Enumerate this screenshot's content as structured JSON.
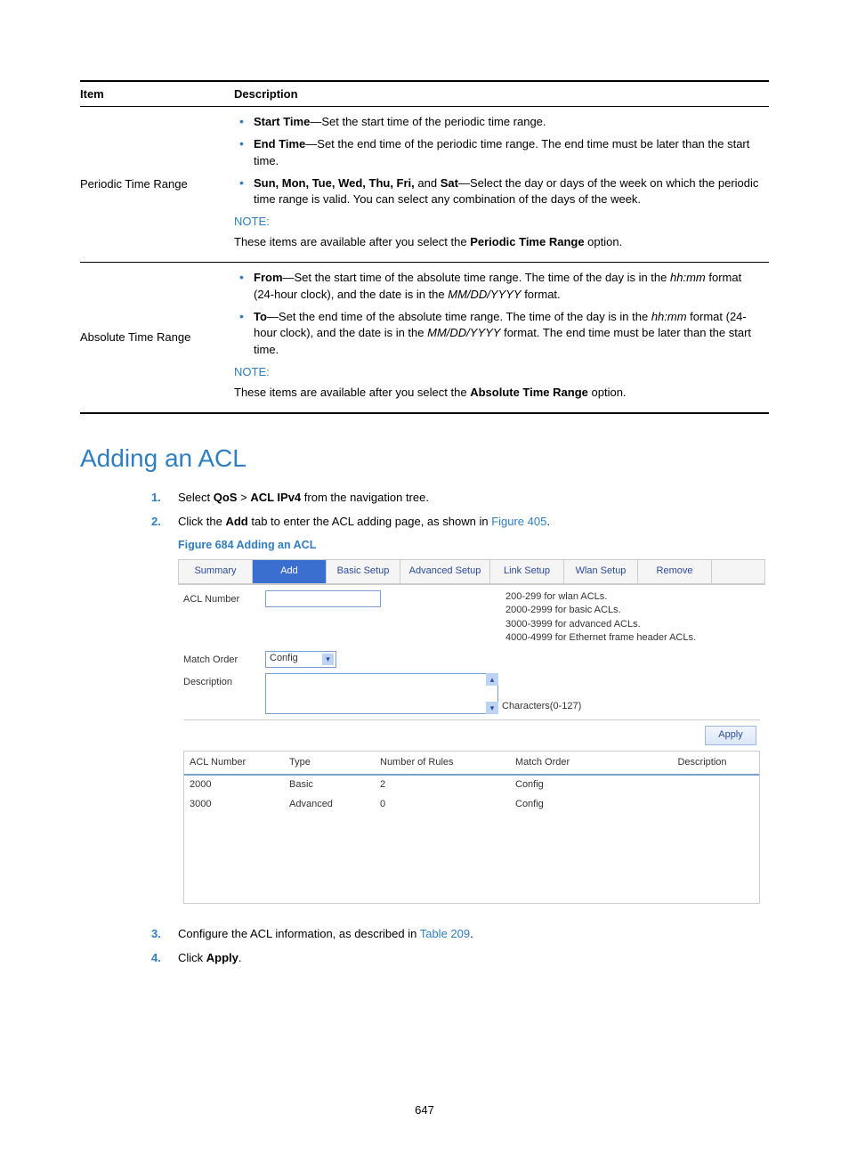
{
  "table": {
    "headers": {
      "item": "Item",
      "description": "Description"
    },
    "rows": [
      {
        "item": "Periodic Time Range",
        "bullets": [
          {
            "label": "Start Time",
            "text": "—Set the start time of the periodic time range."
          },
          {
            "label": "End Time",
            "text": "—Set the end time of the periodic time range. The end time must be later than the start time."
          },
          {
            "label": "",
            "text_prefix": "",
            "days": "Sun, Mon, Tue, Wed, Thu, Fri,",
            "and": " and ",
            "sat": "Sat",
            "text": "—Select the day or days of the week on which the periodic time range is valid. You can select any combination of the days of the week."
          }
        ],
        "note_label": "NOTE:",
        "note_text_pre": "These items are available after you select the ",
        "note_text_bold": "Periodic Time Range",
        "note_text_post": " option."
      },
      {
        "item": "Absolute Time Range",
        "bullets": [
          {
            "label": "From",
            "text": "—Set the start time of the absolute time range. The time of the day is in the ",
            "i1": "hh:mm",
            "mid": " format (24-hour clock), and the date is in the ",
            "i2": "MM/DD/YYYY",
            "tail": " format."
          },
          {
            "label": "To",
            "text": "—Set the end time of the absolute time range. The time of the day is in the ",
            "i1": "hh:mm",
            "mid": " format (24-hour clock), and the date is in the ",
            "i2": "MM/DD/YYYY",
            "tail": " format. The end time must be later than the start time."
          }
        ],
        "note_label": "NOTE:",
        "note_text_pre": "These items are available after you select the ",
        "note_text_bold": "Absolute Time Range",
        "note_text_post": " option."
      }
    ]
  },
  "section_title": "Adding an ACL",
  "steps": {
    "s1_pre": "Select ",
    "s1_b1": "QoS",
    "s1_mid": " > ",
    "s1_b2": "ACL IPv4",
    "s1_post": " from the navigation tree.",
    "s2_pre": "Click the ",
    "s2_b": "Add",
    "s2_mid": " tab to enter the ACL adding page, as shown in ",
    "s2_link": "Figure 405",
    "s2_post": ".",
    "s3_pre": "Configure the ACL information, as described in ",
    "s3_link": "Table 209",
    "s3_post": ".",
    "s4_pre": "Click ",
    "s4_b": "Apply",
    "s4_post": "."
  },
  "figure_caption": "Figure 684 Adding an ACL",
  "ui": {
    "tabs": [
      "Summary",
      "Add",
      "Basic Setup",
      "Advanced Setup",
      "Link Setup",
      "Wlan Setup",
      "Remove"
    ],
    "active_tab_index": 1,
    "labels": {
      "acl_number": "ACL Number",
      "match_order": "Match Order",
      "description": "Description"
    },
    "match_order_value": "Config",
    "char_hint": "Characters(0-127)",
    "hints": [
      "200-299 for wlan ACLs.",
      "2000-2999 for basic ACLs.",
      "3000-3999 for advanced ACLs.",
      "4000-4999 for Ethernet frame header ACLs."
    ],
    "apply": "Apply",
    "list_headers": [
      "ACL Number",
      "Type",
      "Number of Rules",
      "Match Order",
      "Description"
    ],
    "list_rows": [
      {
        "num": "2000",
        "type": "Basic",
        "rules": "2",
        "order": "Config",
        "desc": ""
      },
      {
        "num": "3000",
        "type": "Advanced",
        "rules": "0",
        "order": "Config",
        "desc": ""
      }
    ]
  },
  "page_number": "647"
}
